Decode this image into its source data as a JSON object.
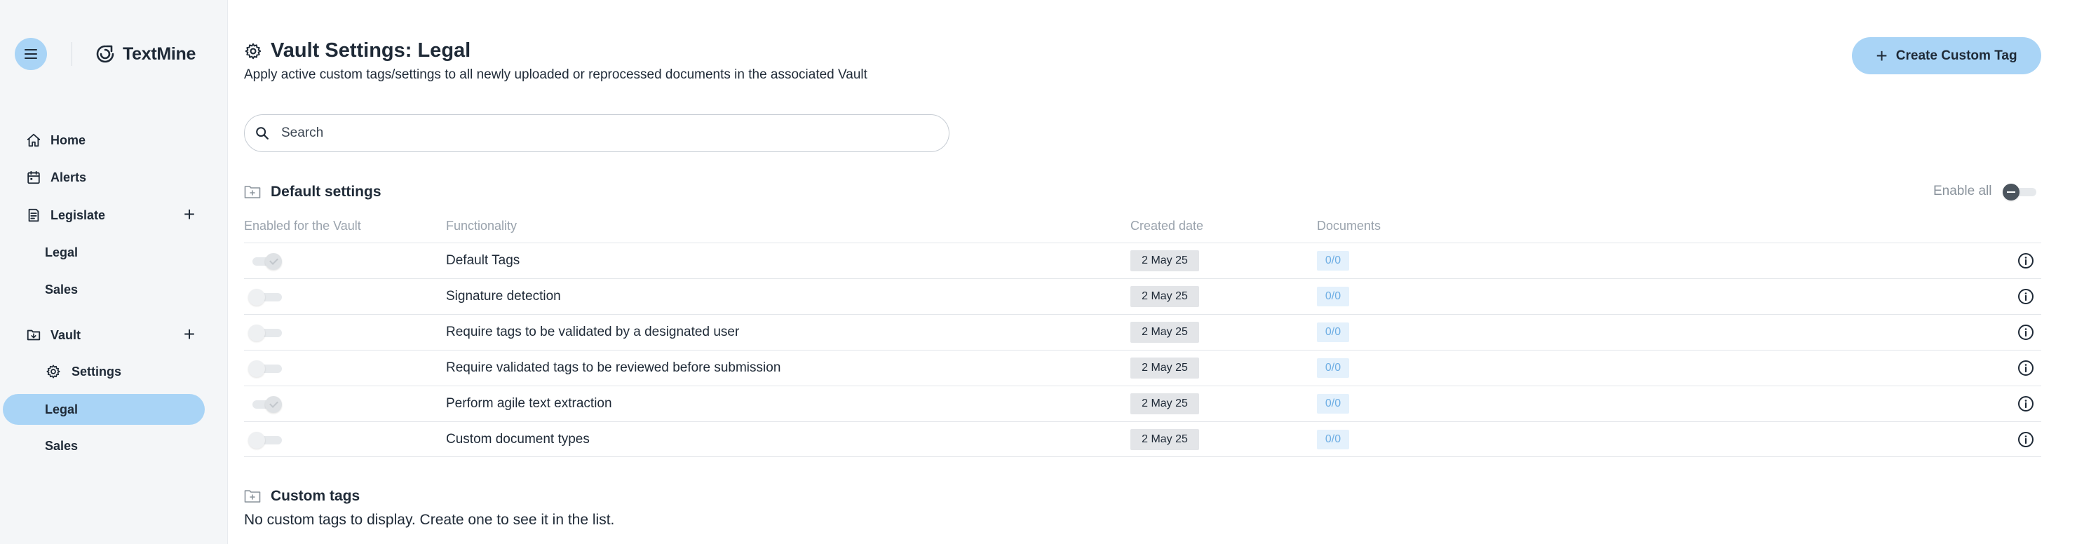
{
  "app": {
    "name": "TextMine"
  },
  "sidebar": {
    "items": [
      {
        "label": "Home",
        "icon": "home-icon"
      },
      {
        "label": "Alerts",
        "icon": "calendar-icon"
      },
      {
        "label": "Legislate",
        "icon": "document-icon",
        "has_add": true
      },
      {
        "label": "Legal"
      },
      {
        "label": "Sales"
      },
      {
        "label": "Vault",
        "icon": "folder-icon",
        "has_add": true
      },
      {
        "label": "Settings",
        "icon": "gear-icon"
      },
      {
        "label": "Legal",
        "active": true
      },
      {
        "label": "Sales"
      }
    ]
  },
  "header": {
    "title": "Vault Settings: Legal",
    "subtitle": "Apply active custom tags/settings to all newly uploaded or reprocessed documents in the associated Vault",
    "create_button_label": "Create Custom Tag"
  },
  "search": {
    "placeholder": "Search",
    "value": ""
  },
  "default_settings": {
    "title": "Default settings",
    "enable_all_label": "Enable all",
    "columns": [
      "Enabled for the Vault",
      "Functionality",
      "Created date",
      "Documents"
    ],
    "rows": [
      {
        "enabled": true,
        "functionality": "Default Tags",
        "created": "2 May 25",
        "documents": "0/0"
      },
      {
        "enabled": false,
        "functionality": "Signature detection",
        "created": "2 May 25",
        "documents": "0/0"
      },
      {
        "enabled": false,
        "functionality": "Require tags to be validated by a designated user",
        "created": "2 May 25",
        "documents": "0/0"
      },
      {
        "enabled": false,
        "functionality": "Require validated tags to be reviewed before submission",
        "created": "2 May 25",
        "documents": "0/0"
      },
      {
        "enabled": true,
        "functionality": "Perform agile text extraction",
        "created": "2 May 25",
        "documents": "0/0"
      },
      {
        "enabled": false,
        "functionality": "Custom document types",
        "created": "2 May 25",
        "documents": "0/0"
      }
    ]
  },
  "custom_tags": {
    "title": "Custom tags",
    "empty_message": "No custom tags to display. Create one to see it in the list."
  },
  "colors": {
    "accent": "#a9d4f6",
    "sidebar_bg": "#f4f6f8",
    "text": "#1f2a37",
    "muted": "#9aa3ad",
    "docs_badge": "#e4f1fc"
  }
}
